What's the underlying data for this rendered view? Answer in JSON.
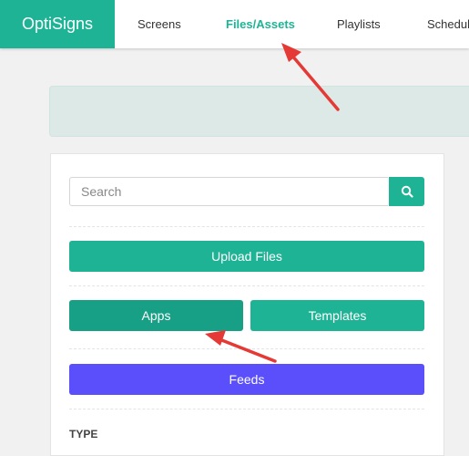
{
  "header": {
    "logo": "OptiSigns",
    "nav": [
      {
        "label": "Screens"
      },
      {
        "label": "Files/Assets"
      },
      {
        "label": "Playlists"
      },
      {
        "label": "Schedul"
      }
    ]
  },
  "sidebar": {
    "search": {
      "placeholder": "Search"
    },
    "upload_label": "Upload Files",
    "apps_label": "Apps",
    "templates_label": "Templates",
    "feeds_label": "Feeds",
    "type_heading": "TYPE"
  },
  "colors": {
    "brand": "#1fb395",
    "feeds": "#5b4ffc",
    "annotation_arrow": "#e53935"
  },
  "icons": [
    "search-icon"
  ]
}
